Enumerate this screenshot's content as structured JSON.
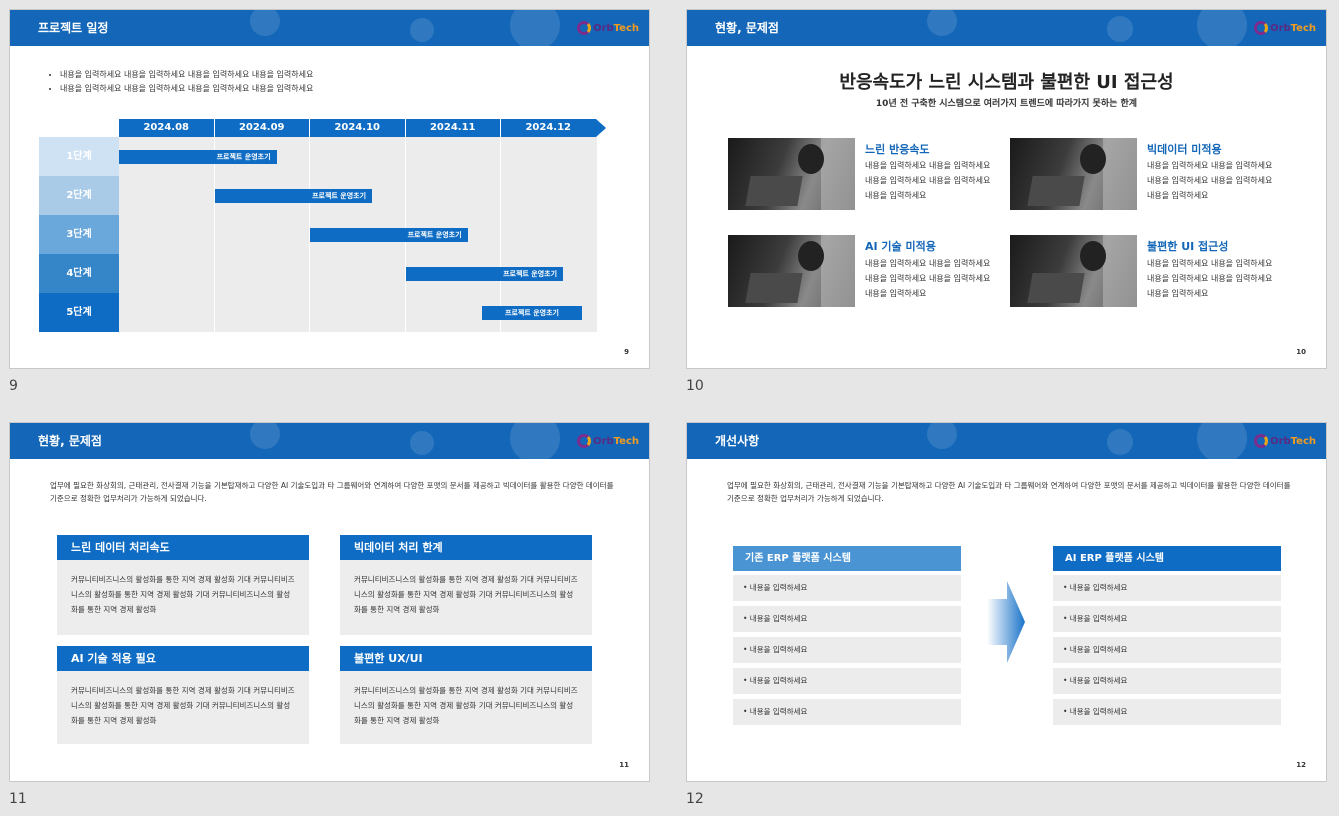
{
  "logo": {
    "orb": "Orb",
    "tech": "Tech"
  },
  "slides": [
    {
      "number": "9",
      "title": "프로젝트 일정",
      "page_no": "9",
      "bullets": [
        "내용을 입력하세요 내용을 입력하세요 내용을 입력하세요 내용을 입력하세요",
        "내용을 입력하세요 내용을 입력하세요 내용을 입력하세요 내용을 입력하세요"
      ],
      "months": [
        "2024.08",
        "2024.09",
        "2024.10",
        "2024.11",
        "2024.12"
      ],
      "stages": [
        "1단계",
        "2단계",
        "3단계",
        "4단계",
        "5단계"
      ],
      "bar_label": "프로젝트 운영초기",
      "stage_colors": [
        "#cfe2f3",
        "#a9cbe8",
        "#6aa7da",
        "#3585c9",
        "#0e6cc4"
      ]
    },
    {
      "number": "10",
      "title": "현황, 문제점",
      "page_no": "10",
      "headline": "반응속도가 느린 시스템과 불편한 UI 접근성",
      "subline": "10년 전 구축한 시스템으로 여러가지 트렌드에 따라가지 못하는 한계",
      "features": [
        {
          "title": "느린 반응속도",
          "body": "내용을 입력하세요 내용을 입력하세요 내용을 입력하세요 내용을 입력하세요 내용을 입력하세요"
        },
        {
          "title": "빅데이터 미적용",
          "body": "내용을 입력하세요 내용을 입력하세요 내용을 입력하세요 내용을 입력하세요 내용을 입력하세요"
        },
        {
          "title": "AI 기술 미적용",
          "body": "내용을 입력하세요 내용을 입력하세요 내용을 입력하세요 내용을 입력하세요 내용을 입력하세요"
        },
        {
          "title": "불편한 UI 접근성",
          "body": "내용을 입력하세요 내용을 입력하세요 내용을 입력하세요 내용을 입력하세요 내용을 입력하세요"
        }
      ]
    },
    {
      "number": "11",
      "title": "현황, 문제점",
      "page_no": "11",
      "intro": "업무에 필요한 화상회의, 근태관리, 전사결재 기능을 기본탑재하고 다양한 AI 기술도입과 타 그룹웨어와 연계하여 다양한 포맷의 문서를 제공하고 빅데이터를 활용한 다양한 데이터를 기준으로 정확한 업무처리가 가능하게 되었습니다.",
      "boxes": [
        {
          "title": "느린 데이터 처리속도",
          "body": "커뮤니티비즈니스의 활성화를 통한 지역 경제 활성화 기대 커뮤니티비즈니스의 활성화를 통한 지역 경제 활성화 기대 커뮤니티비즈니스의 활성화를 통한 지역 경제 활성화"
        },
        {
          "title": "빅데이터 처리 한계",
          "body": "커뮤니티비즈니스의 활성화를 통한 지역 경제 활성화 기대 커뮤니티비즈니스의 활성화를 통한 지역 경제 활성화 기대 커뮤니티비즈니스의 활성화를 통한 지역 경제 활성화"
        },
        {
          "title": "AI 기술 적용 필요",
          "body": "커뮤니티비즈니스의 활성화를 통한 지역 경제 활성화 기대 커뮤니티비즈니스의 활성화를 통한 지역 경제 활성화 기대 커뮤니티비즈니스의 활성화를 통한 지역 경제 활성화"
        },
        {
          "title": "불편한 UX/UI",
          "body": "커뮤니티비즈니스의 활성화를 통한 지역 경제 활성화 기대 커뮤니티비즈니스의 활성화를 통한 지역 경제 활성화 기대 커뮤니티비즈니스의 활성화를 통한 지역 경제 활성화"
        }
      ]
    },
    {
      "number": "12",
      "title": "개선사항",
      "page_no": "12",
      "intro": "업무에 필요한 화상회의, 근태관리, 전사결재 기능을 기본탑재하고 다양한 AI 기술도입과 타 그룹웨어와 연계하여 다양한 포맷의 문서를 제공하고 빅데이터를 활용한 다양한 데이터를 기준으로 정확한 업무처리가 가능하게 되었습니다.",
      "left_title": "기존 ERP 플랫폼 시스템",
      "right_title": "AI ERP 플랫폼 시스템",
      "left_items": [
        "• 내용을 입력하세요",
        "• 내용을 입력하세요",
        "• 내용을 입력하세요",
        "• 내용을 입력하세요",
        "• 내용을 입력하세요"
      ],
      "right_items": [
        "• 내용을 입력하세요",
        "• 내용을 입력하세요",
        "• 내용을 입력하세요",
        "• 내용을 입력하세요",
        "• 내용을 입력하세요"
      ]
    }
  ]
}
